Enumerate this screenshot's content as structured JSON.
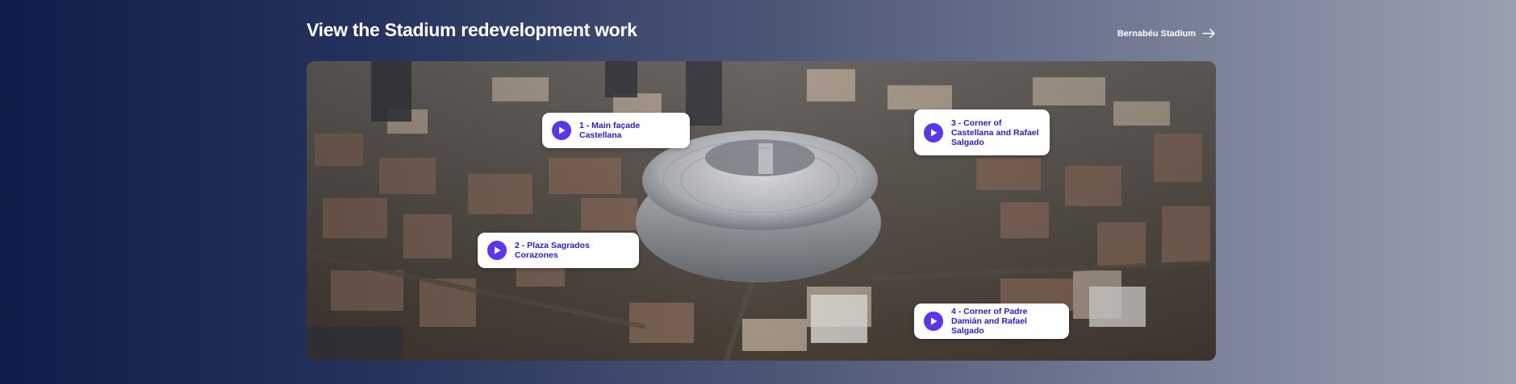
{
  "header": {
    "title": "View the Stadium redevelopment work",
    "link_label": "Bernabéu Stadium",
    "link_icon": "arrow-right-icon"
  },
  "media": {
    "hotspots": [
      {
        "label": "1 - Main façade Castellana",
        "icon": "play-icon"
      },
      {
        "label": "2 - Plaza Sagrados Corazones",
        "icon": "play-icon"
      },
      {
        "label": "3 - Corner of Castellana and Rafael Salgado",
        "icon": "play-icon"
      },
      {
        "label": "4 - Corner of Padre Damián and Rafael Salgado",
        "icon": "play-icon"
      }
    ]
  },
  "colors": {
    "accent": "#5a35ee",
    "hotspot_text": "#2c1bc9",
    "bg_start": "#0f1d4a",
    "bg_end": "#9aa0b0"
  }
}
